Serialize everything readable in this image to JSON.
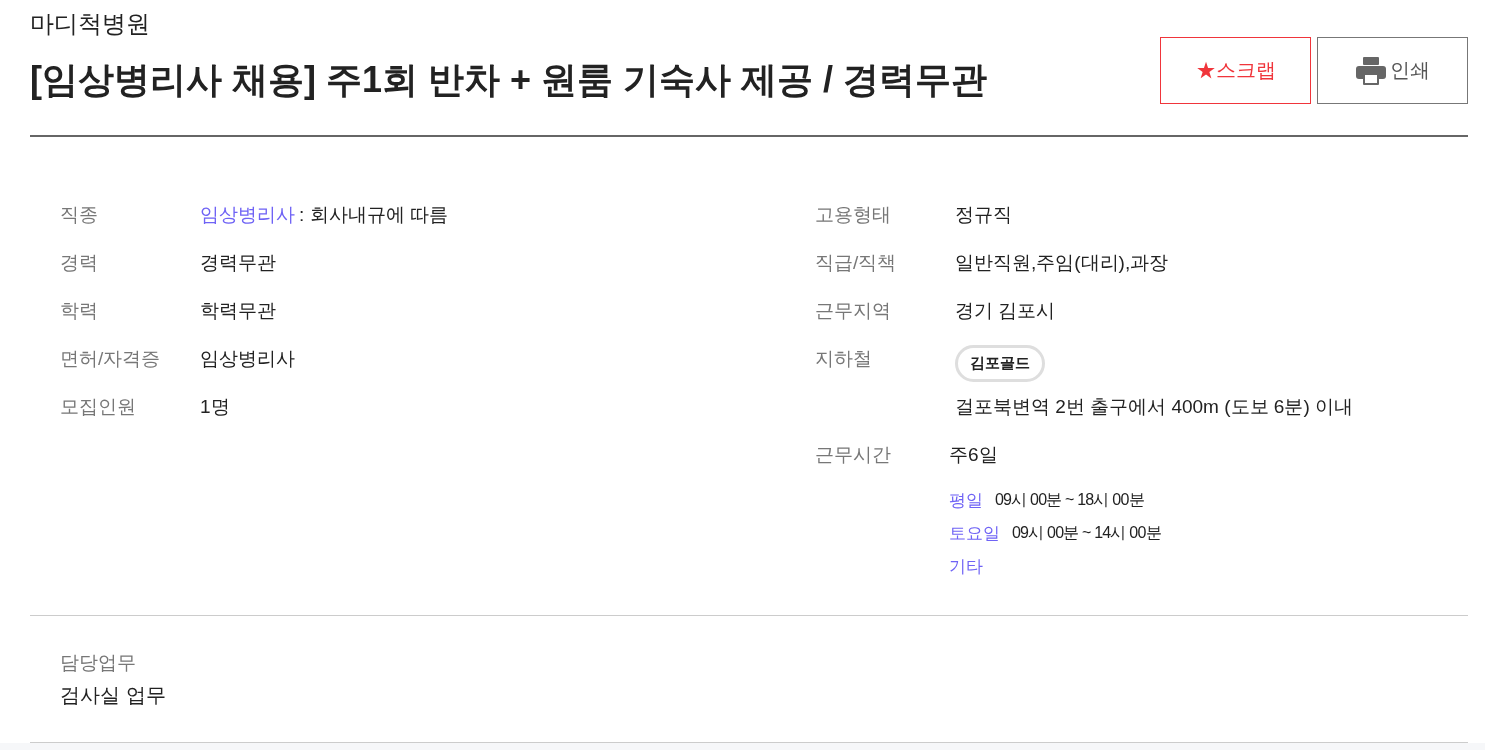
{
  "company": "마디척병원",
  "title": "[임상병리사 채용] 주1회 반차 + 원룸 기숙사 제공 / 경력무관",
  "actions": [
    {
      "kind": "scrap",
      "label": "★스크랩"
    },
    {
      "kind": "print",
      "label": "인쇄"
    }
  ],
  "left_fields": [
    {
      "kind": "link_text",
      "label": "직종",
      "link": "임상병리사",
      "value": ": 회사내규에 따름"
    },
    {
      "kind": "text",
      "label": "경력",
      "value": "경력무관"
    },
    {
      "kind": "text",
      "label": "학력",
      "value": "학력무관"
    },
    {
      "kind": "text",
      "label": "면허/자격증",
      "value": "임상병리사"
    },
    {
      "kind": "text",
      "label": "모집인원",
      "value": "1명"
    }
  ],
  "right_fields": [
    {
      "kind": "text",
      "label": "고용형태",
      "value": "정규직"
    },
    {
      "kind": "text",
      "label": "직급/직책",
      "value": "일반직원,주임(대리),과장"
    },
    {
      "kind": "text",
      "label": "근무지역",
      "value": "경기 김포시"
    },
    {
      "kind": "subway",
      "label": "지하철",
      "line": "김포골드",
      "value": "걸포북변역 2번 출구에서 400m (도보 6분) 이내"
    },
    {
      "kind": "schedule",
      "label": "근무시간",
      "value": "주6일",
      "schedules": [
        {
          "day": "평일",
          "time": "09시 00분 ~ 18시 00분"
        },
        {
          "day": "토요일",
          "time": "09시 00분 ~ 14시 00분"
        },
        {
          "day": "기타"
        }
      ]
    }
  ],
  "duties": {
    "label": "담당업무",
    "value": "검사실 업무"
  }
}
